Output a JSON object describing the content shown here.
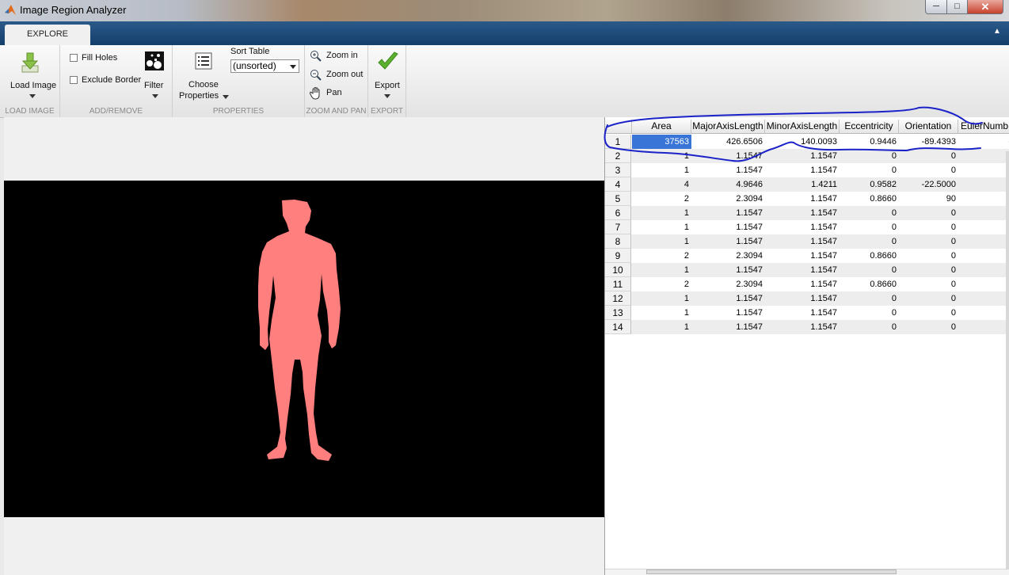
{
  "window": {
    "title": "Image Region Analyzer",
    "minimize_glyph": "─",
    "maximize_glyph": "□",
    "close_glyph": "✕"
  },
  "tabs": [
    {
      "label": "EXPLORE",
      "active": true
    }
  ],
  "ribbon": {
    "load_image": {
      "label": "Load Image",
      "section": "LOAD IMAGE",
      "icon": "load-image-icon"
    },
    "add_remove": {
      "fill_holes": "Fill Holes",
      "exclude_border": "Exclude Border",
      "filter": "Filter",
      "section": "ADD/REMOVE"
    },
    "properties": {
      "choose_line1": "Choose",
      "choose_line2": "Properties",
      "sort_label": "Sort Table",
      "sort_value": "(unsorted)",
      "section": "PROPERTIES"
    },
    "zoom_pan": {
      "zoom_in": "Zoom in",
      "zoom_out": "Zoom out",
      "pan": "Pan",
      "section": "ZOOM AND PAN"
    },
    "export": {
      "label": "Export",
      "section": "EXPORT"
    }
  },
  "image": {
    "background": "#000000",
    "region_color": "#ff7f7f"
  },
  "table": {
    "columns": [
      "Area",
      "MajorAxisLength",
      "MinorAxisLength",
      "Eccentricity",
      "Orientation",
      "EulerNumb"
    ],
    "rows": [
      [
        "1",
        "37563",
        "426.6506",
        "140.0093",
        "0.9446",
        "-89.4393",
        "-"
      ],
      [
        "2",
        "1",
        "1.1547",
        "1.1547",
        "0",
        "0",
        ""
      ],
      [
        "3",
        "1",
        "1.1547",
        "1.1547",
        "0",
        "0",
        ""
      ],
      [
        "4",
        "4",
        "4.9646",
        "1.4211",
        "0.9582",
        "-22.5000",
        ""
      ],
      [
        "5",
        "2",
        "2.3094",
        "1.1547",
        "0.8660",
        "90",
        ""
      ],
      [
        "6",
        "1",
        "1.1547",
        "1.1547",
        "0",
        "0",
        ""
      ],
      [
        "7",
        "1",
        "1.1547",
        "1.1547",
        "0",
        "0",
        ""
      ],
      [
        "8",
        "1",
        "1.1547",
        "1.1547",
        "0",
        "0",
        ""
      ],
      [
        "9",
        "2",
        "2.3094",
        "1.1547",
        "0.8660",
        "0",
        ""
      ],
      [
        "10",
        "1",
        "1.1547",
        "1.1547",
        "0",
        "0",
        ""
      ],
      [
        "11",
        "2",
        "2.3094",
        "1.1547",
        "0.8660",
        "0",
        ""
      ],
      [
        "12",
        "1",
        "1.1547",
        "1.1547",
        "0",
        "0",
        ""
      ],
      [
        "13",
        "1",
        "1.1547",
        "1.1547",
        "0",
        "0",
        ""
      ],
      [
        "14",
        "1",
        "1.1547",
        "1.1547",
        "0",
        "0",
        ""
      ]
    ],
    "selected": {
      "row": 0,
      "col": 1
    }
  },
  "annotation": {
    "color": "#1a22c8"
  }
}
